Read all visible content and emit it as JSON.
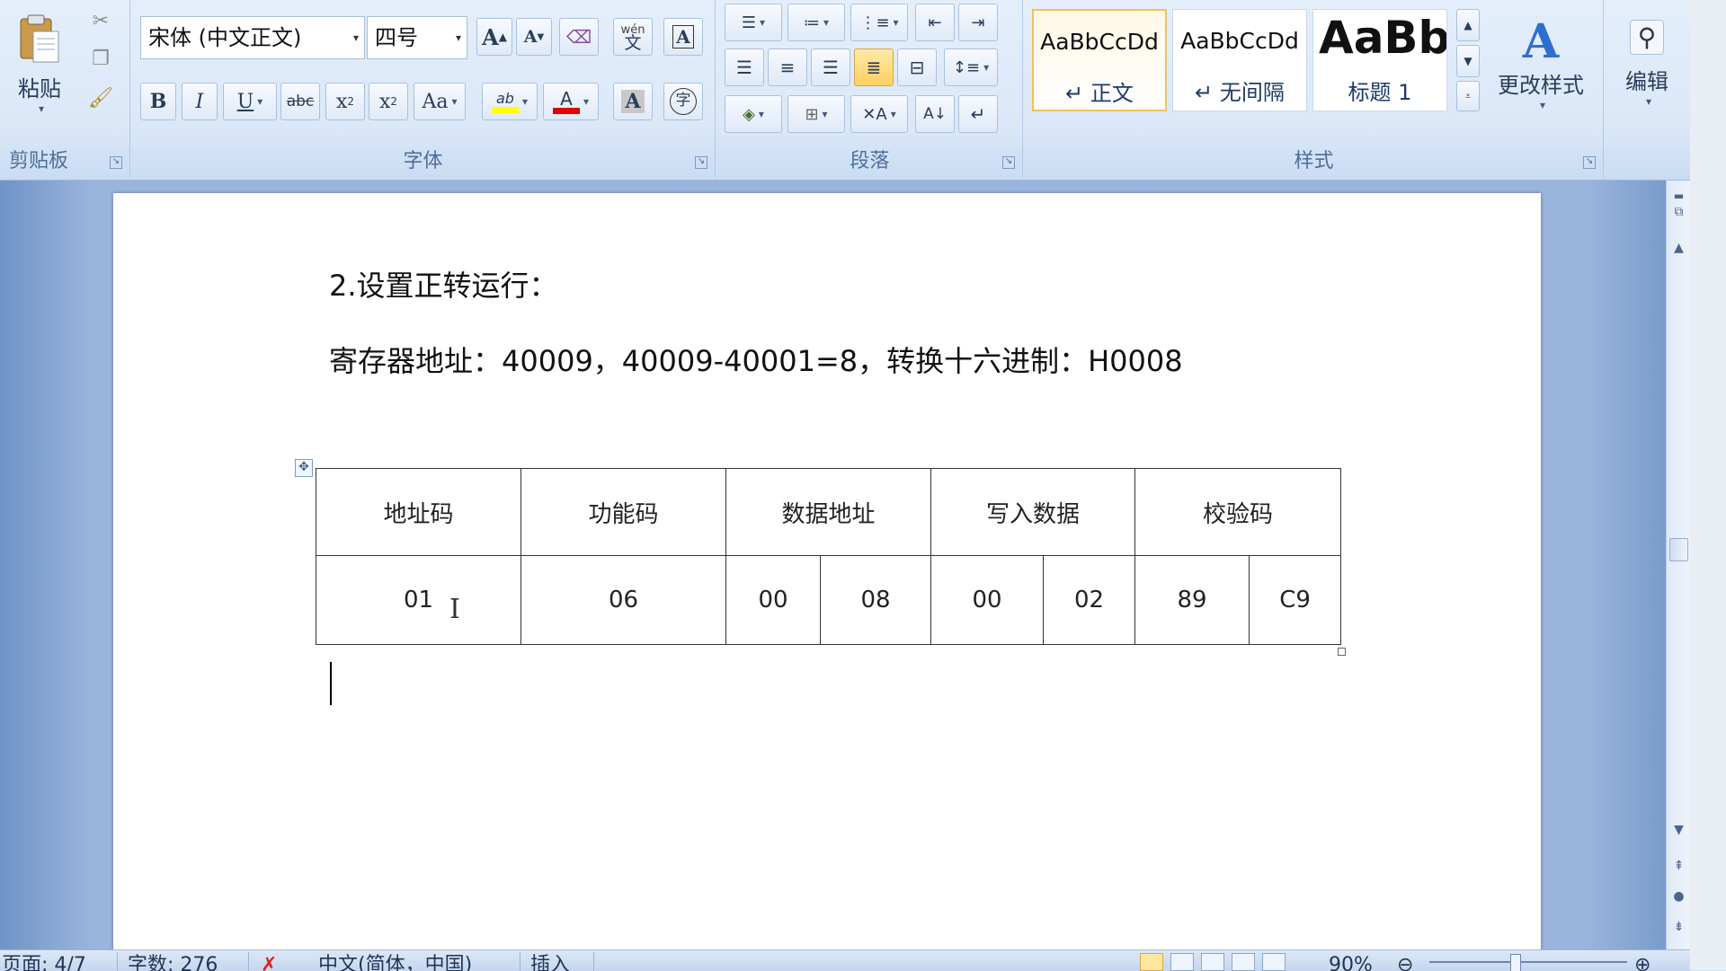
{
  "ribbon": {
    "clipboard": {
      "paste_label": "粘贴",
      "group_label": "剪贴板",
      "icons": [
        "paste-icon",
        "cut-icon",
        "copy-icon",
        "format-painter-icon"
      ]
    },
    "font": {
      "group_label": "字体",
      "font_name": "宋体 (中文正文)",
      "font_size": "四号",
      "grow_font": "A",
      "shrink_font": "A",
      "phonetic": "wén",
      "bold": "B",
      "italic": "I",
      "underline": "U",
      "strike": "abc",
      "subscript": "x",
      "superscript": "x",
      "change_case": "Aa",
      "highlight": "ab",
      "font_color": "A",
      "char_shading": "A",
      "enclose_char": "字",
      "border_char": "A",
      "font_color_hex": "#e00000",
      "highlight_hex": "#ffff00"
    },
    "paragraph": {
      "group_label": "段落"
    },
    "styles": {
      "group_label": "样式",
      "tiles": [
        {
          "sample": "AaBbCcDd",
          "name": "↵ 正文"
        },
        {
          "sample": "AaBbCcDd",
          "name": "↵ 无间隔"
        },
        {
          "sample": "AaBb",
          "name": "标题 1"
        }
      ],
      "change_styles_label": "更改样式"
    },
    "editing": {
      "label": "编辑"
    }
  },
  "document": {
    "heading": "2.设置正转运行：",
    "register_line": "寄存器地址：40009，40009-40001=8，转换十六进制：H0008",
    "table": {
      "headers": [
        "地址码",
        "功能码",
        "数据地址",
        "写入数据",
        "校验码"
      ],
      "values": {
        "address": "01",
        "function": "06",
        "data_address": [
          "00",
          "08"
        ],
        "write_data": [
          "00",
          "02"
        ],
        "checksum": [
          "89",
          "C9"
        ]
      }
    }
  },
  "statusbar": {
    "page": "页面: 4/7",
    "words": "字数: 276",
    "language": "中文(简体，中国)",
    "mode": "插入",
    "zoom": "90%"
  }
}
